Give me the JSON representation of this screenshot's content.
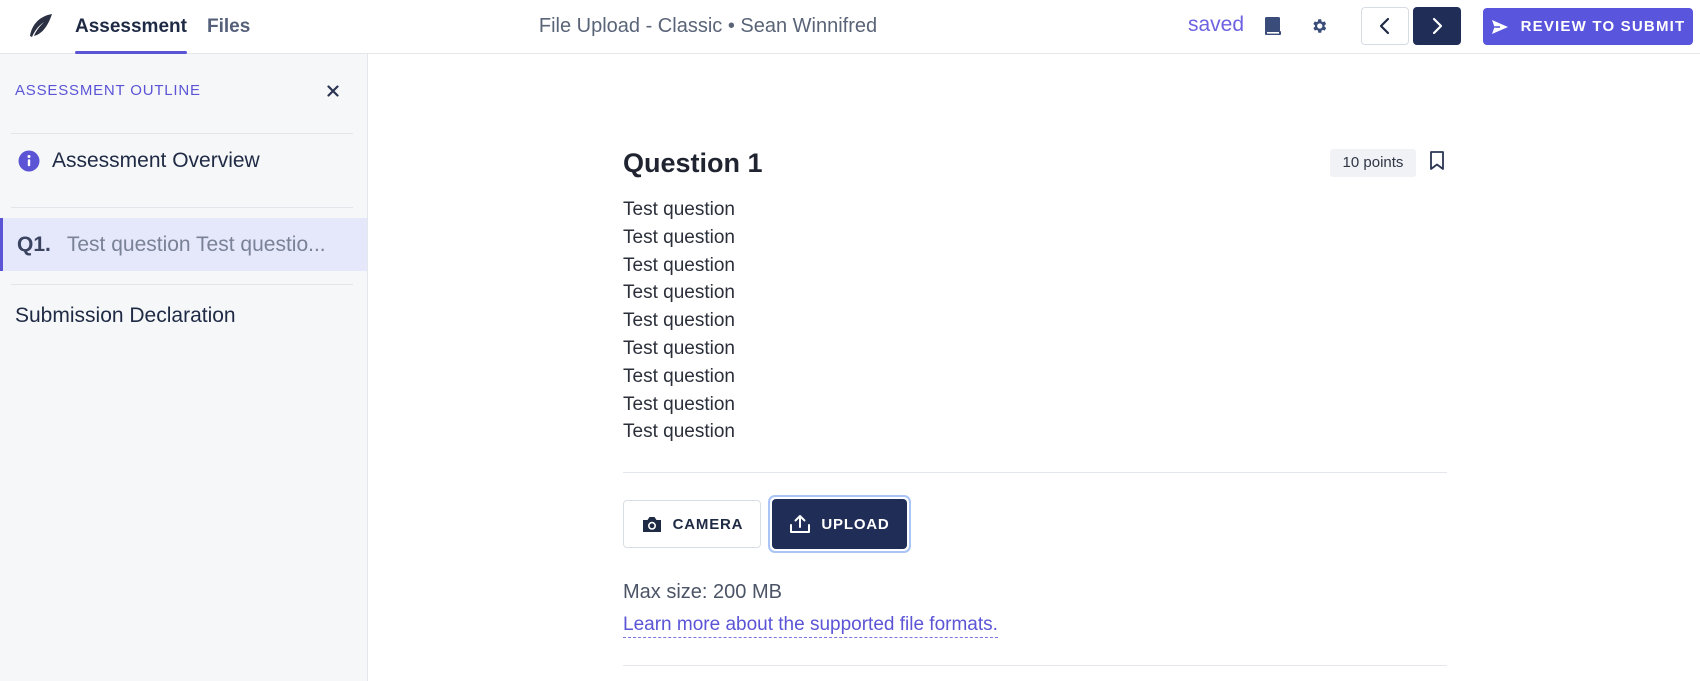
{
  "header": {
    "tabs": [
      {
        "label": "Assessment",
        "active": true
      },
      {
        "label": "Files",
        "active": false
      }
    ],
    "title": "File Upload - Classic • Sean Winnifred",
    "save_status": "saved",
    "review_label": "REVIEW TO SUBMIT",
    "icons": [
      "feather-logo-icon",
      "book-icon",
      "gear-icon",
      "chevron-left-icon",
      "chevron-right-icon",
      "send-icon"
    ]
  },
  "sidebar": {
    "title": "ASSESSMENT OUTLINE",
    "overview_label": "Assessment Overview",
    "question_item": {
      "number": "Q1.",
      "preview": "Test question Test questio..."
    },
    "declaration_label": "Submission Declaration"
  },
  "question": {
    "title": "Question 1",
    "points": "10 points",
    "lines": [
      "Test question",
      "Test question",
      "Test question",
      "Test question",
      "Test question",
      "Test question",
      "Test question",
      "Test question",
      "Test question"
    ]
  },
  "upload": {
    "camera_label": "CAMERA",
    "upload_label": "UPLOAD",
    "max_size": "Max size: 200 MB",
    "formats_link": "Learn more about the supported file formats."
  },
  "colors": {
    "accent": "#5b55d6",
    "navy": "#1f2d57",
    "sidebar_bg": "#f6f7f9",
    "selected_bg": "#e5e8fb"
  }
}
